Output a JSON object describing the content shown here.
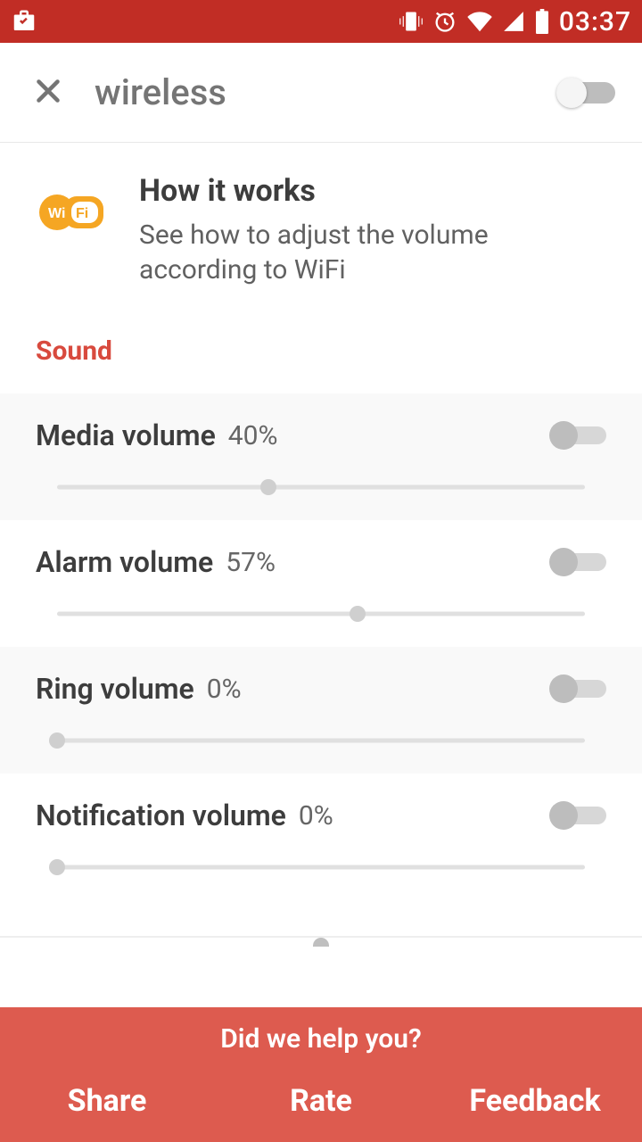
{
  "status": {
    "time": "03:37"
  },
  "header": {
    "title": "wireless",
    "master_toggle": false
  },
  "how": {
    "title": "How it works",
    "desc": "See how to adjust the volume according to WiFi"
  },
  "section_label": "Sound",
  "volumes": [
    {
      "label": "Media volume",
      "pct": "40%",
      "value": 40,
      "toggle": false,
      "shaded": true
    },
    {
      "label": "Alarm volume",
      "pct": "57%",
      "value": 57,
      "toggle": false,
      "shaded": false
    },
    {
      "label": "Ring volume",
      "pct": "0%",
      "value": 0,
      "toggle": false,
      "shaded": true
    },
    {
      "label": "Notification volume",
      "pct": "0%",
      "value": 0,
      "toggle": false,
      "shaded": false
    }
  ],
  "footer": {
    "prompt": "Did we help you?",
    "share": "Share",
    "rate": "Rate",
    "feedback": "Feedback"
  }
}
